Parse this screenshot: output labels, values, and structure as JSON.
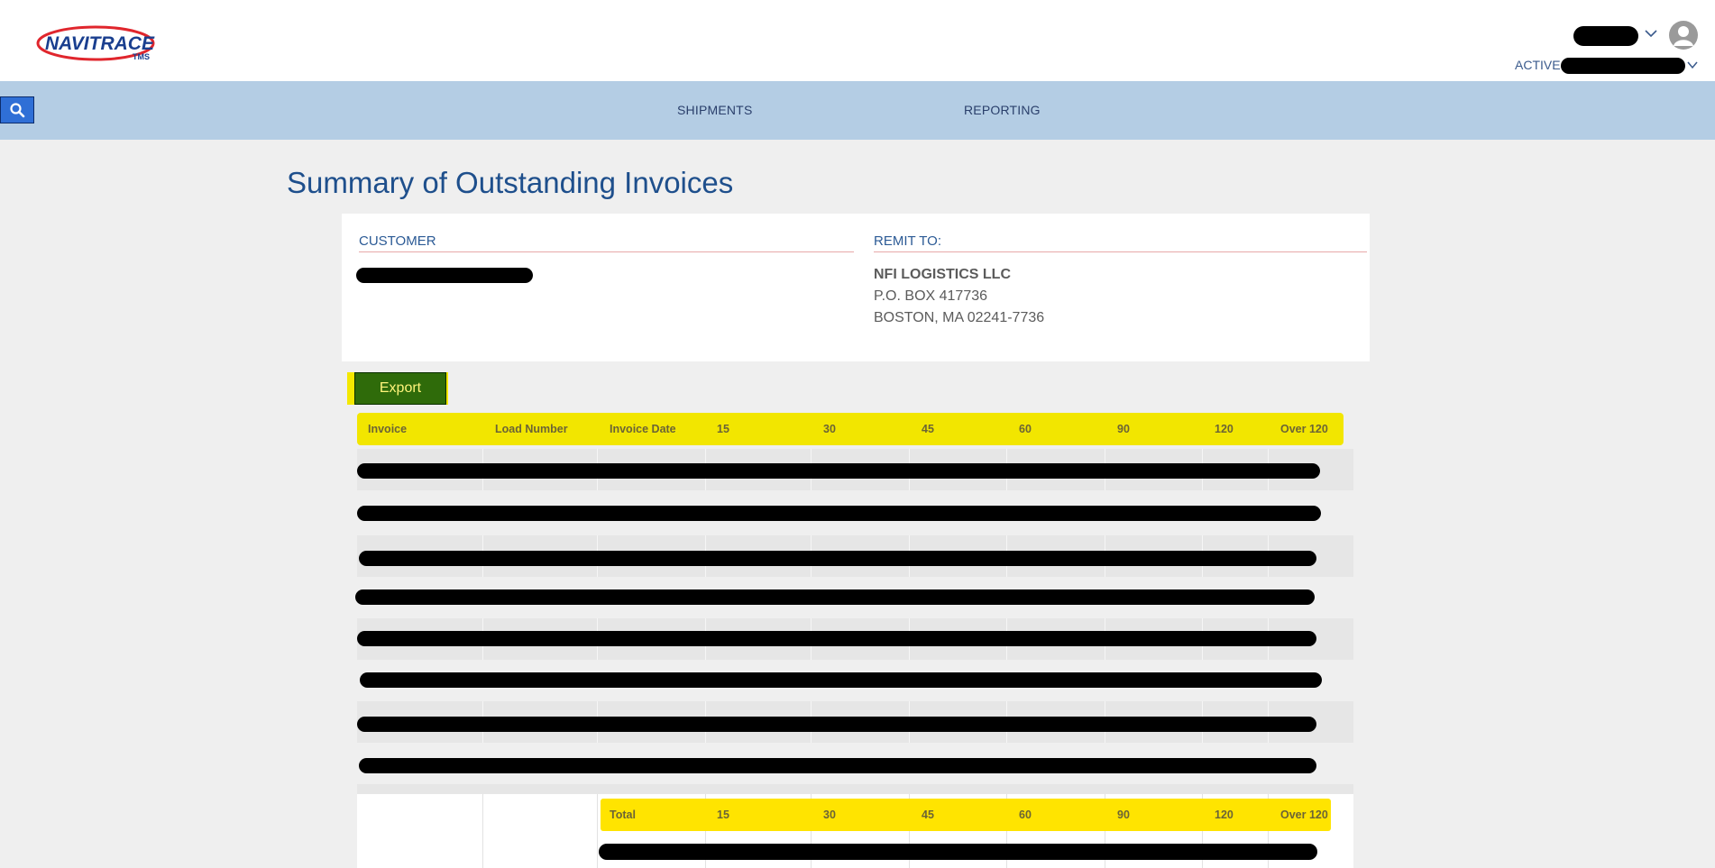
{
  "header": {
    "logo_text": "NAVITRACE",
    "logo_sub": "TMS",
    "active_label": "ACTIVE"
  },
  "nav": {
    "items": [
      "SHIPMENTS",
      "REPORTING"
    ]
  },
  "page": {
    "title": "Summary of Outstanding Invoices"
  },
  "customer": {
    "label": "CUSTOMER"
  },
  "remit": {
    "label": "REMIT TO:",
    "name": "NFI LOGISTICS LLC",
    "address_line1": "P.O. BOX 417736",
    "address_line2": "BOSTON, MA 02241-7736"
  },
  "actions": {
    "export_label": "Export"
  },
  "table": {
    "columns": [
      "Invoice",
      "Load Number",
      "Invoice Date",
      "15",
      "30",
      "45",
      "60",
      "90",
      "120",
      "Over 120"
    ],
    "rows": 8
  },
  "totals": {
    "columns": [
      "Total",
      "15",
      "30",
      "45",
      "60",
      "90",
      "120",
      "Over 120"
    ]
  },
  "colors": {
    "title": "#1e4f8c",
    "nav_bg": "#b4cde4",
    "highlight": "#f2e600",
    "export_bg": "#2f6b0a"
  }
}
